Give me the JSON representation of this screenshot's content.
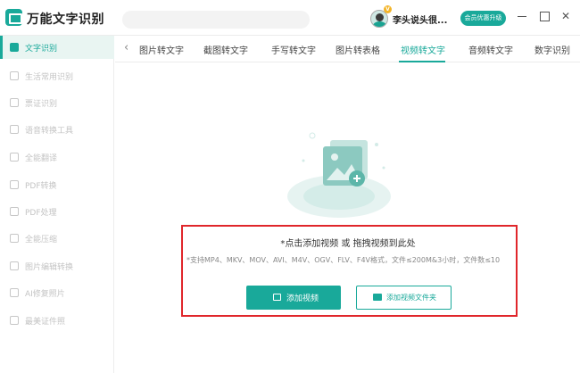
{
  "app": {
    "title": "万能文字识别"
  },
  "user": {
    "name": "李头说头很...",
    "vip_badge": "V"
  },
  "header": {
    "upgrade_label": "会员优惠升级"
  },
  "window_controls": {
    "minimize": "",
    "maximize": "",
    "close": "✕"
  },
  "sidebar": {
    "items": [
      {
        "label": "文字识别",
        "active": true
      },
      {
        "label": "生活常用识别"
      },
      {
        "label": "票证识别"
      },
      {
        "label": "语音转换工具"
      },
      {
        "label": "全能翻译"
      },
      {
        "label": "PDF转换"
      },
      {
        "label": "PDF处理"
      },
      {
        "label": "全能压缩"
      },
      {
        "label": "图片编辑转换"
      },
      {
        "label": "AI修复照片"
      },
      {
        "label": "最美证件照"
      }
    ]
  },
  "tabs": {
    "back_icon": "‹",
    "items": [
      {
        "label": "图片转文字"
      },
      {
        "label": "截图转文字"
      },
      {
        "label": "手写转文字"
      },
      {
        "label": "图片转表格"
      },
      {
        "label": "视频转文字",
        "active": true
      },
      {
        "label": "音频转文字"
      },
      {
        "label": "数字识别"
      }
    ]
  },
  "upload": {
    "title": "*点击添加视频 或 拖拽视频到此处",
    "hint": "*支持MP4、MKV、MOV、AVI、M4V、OGV、FLV、F4V格式，文件≤200M&3小时，文件数≤10",
    "add_video_label": "添加视频",
    "add_folder_label": "添加视频文件夹"
  },
  "colors": {
    "accent": "#19a99a",
    "highlight_border": "#e0262b"
  }
}
